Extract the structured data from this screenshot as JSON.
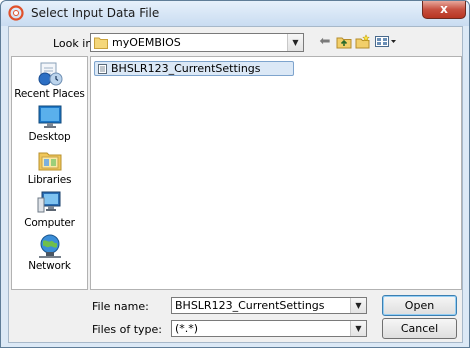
{
  "window": {
    "title": "Select Input Data File",
    "close_label": "x"
  },
  "toolbar": {
    "lookin_label": "Look in:",
    "lookin_value": "myOEMBIOS",
    "back_icon": "back-arrow-icon",
    "up_icon": "up-folder-icon",
    "new_folder_icon": "new-folder-icon",
    "view_icon": "view-menu-icon"
  },
  "places": [
    {
      "label": "Recent Places",
      "icon": "recent-places-icon"
    },
    {
      "label": "Desktop",
      "icon": "desktop-icon"
    },
    {
      "label": "Libraries",
      "icon": "libraries-icon"
    },
    {
      "label": "Computer",
      "icon": "computer-icon"
    },
    {
      "label": "Network",
      "icon": "network-icon"
    }
  ],
  "files": [
    {
      "name": "BHSLR123_CurrentSettings",
      "selected": true
    }
  ],
  "form": {
    "filename_label": "File name:",
    "filename_value": "BHSLR123_CurrentSettings",
    "filetype_label": "Files of type:",
    "filetype_value": "(*.*)"
  },
  "buttons": {
    "open_label": "Open",
    "cancel_label": "Cancel"
  },
  "colors": {
    "frame": "#dce9f6",
    "close": "#c75040",
    "selection": "#dbe8f6"
  }
}
